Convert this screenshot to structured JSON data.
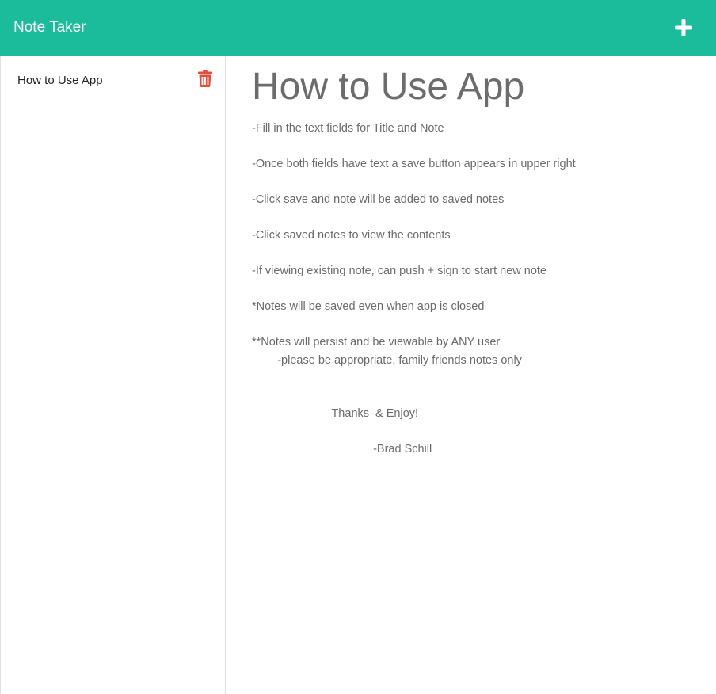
{
  "header": {
    "title": "Note Taker",
    "add_icon": "plus-icon",
    "accent_color": "#1abc9c"
  },
  "sidebar": {
    "notes": [
      {
        "title": "How to Use App",
        "delete_icon": "trash-icon",
        "delete_color": "#e74c3c"
      }
    ]
  },
  "main": {
    "note_title": "How to Use App",
    "note_text": "-Fill in the text fields for Title and Note\n\n-Once both fields have text a save button appears in upper right\n\n-Click save and note will be added to saved notes\n\n-Click saved notes to view the contents\n\n-If viewing existing note, can push + sign to start new note\n\n*Notes will be saved even when app is closed\n\n**Notes will persist and be viewable by ANY user\n        -please be appropriate, family friends notes only\n\n\n                         Thanks  & Enjoy!\n\n                                      -Brad Schill"
  }
}
